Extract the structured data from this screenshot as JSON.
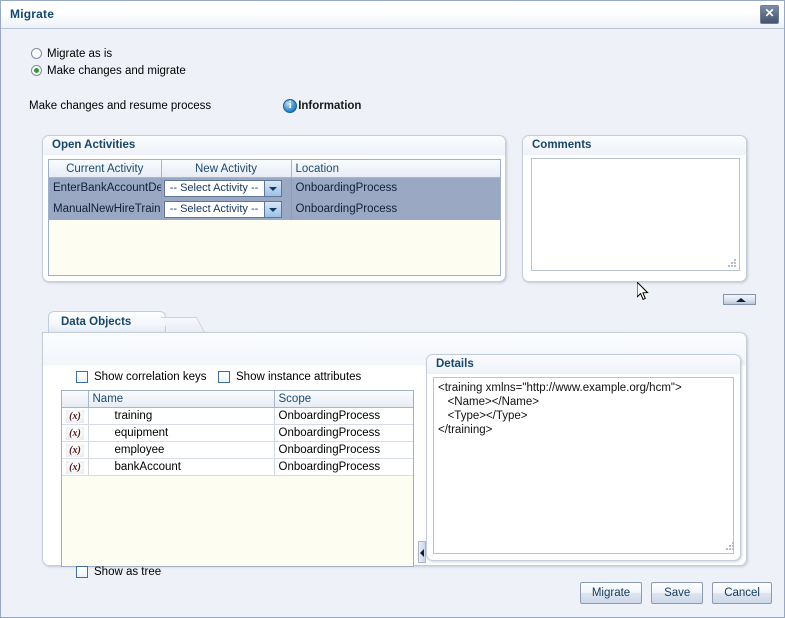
{
  "window": {
    "title": "Migrate",
    "close_icon": "close-icon"
  },
  "options": {
    "migrate_as_is": "Migrate as is",
    "make_changes_and_migrate": "Make changes and migrate",
    "selected": "make_changes_and_migrate"
  },
  "info": {
    "note": "Make changes and resume process",
    "icon": "information-icon",
    "label": "Information"
  },
  "open_activities": {
    "title": "Open Activities",
    "columns": [
      "Current Activity",
      "New Activity",
      "Location"
    ],
    "rows": [
      {
        "current_activity": "EnterBankAccountDet",
        "new_activity": "-- Select Activity --",
        "location": "OnboardingProcess",
        "selected": true
      },
      {
        "current_activity": "ManualNewHireTrainin",
        "new_activity": "-- Select Activity --",
        "location": "OnboardingProcess",
        "selected": true
      }
    ]
  },
  "comments": {
    "title": "Comments",
    "value": "",
    "placeholder": ""
  },
  "collapse_pill": {
    "icon": "collapse-up-icon"
  },
  "data_objects": {
    "tab_label": "Data Objects",
    "show_correlation_keys": {
      "label": "Show correlation keys",
      "checked": false
    },
    "show_instance_attributes": {
      "label": "Show instance attributes",
      "checked": false
    },
    "show_as_tree": {
      "label": "Show as tree",
      "checked": false
    },
    "columns": [
      "",
      "Name",
      "Scope"
    ],
    "rows": [
      {
        "icon": "(x)",
        "name": "training",
        "scope": "OnboardingProcess"
      },
      {
        "icon": "(x)",
        "name": "equipment",
        "scope": "OnboardingProcess"
      },
      {
        "icon": "(x)",
        "name": "employee",
        "scope": "OnboardingProcess"
      },
      {
        "icon": "(x)",
        "name": "bankAccount",
        "scope": "OnboardingProcess"
      }
    ]
  },
  "details": {
    "title": "Details",
    "content": "<training xmlns=\"http://www.example.org/hcm\">\n   <Name></Name>\n   <Type></Type>\n</training>"
  },
  "footer": {
    "migrate": "Migrate",
    "save": "Save",
    "cancel": "Cancel"
  },
  "colors": {
    "dialog_background": "#eef1f7",
    "title_text": "#15476b",
    "selected_row": "#9aa8c4",
    "grid_background": "#fdfdf2",
    "radio_selected": "#2f9e2f",
    "info_icon": "#3f92d2"
  }
}
